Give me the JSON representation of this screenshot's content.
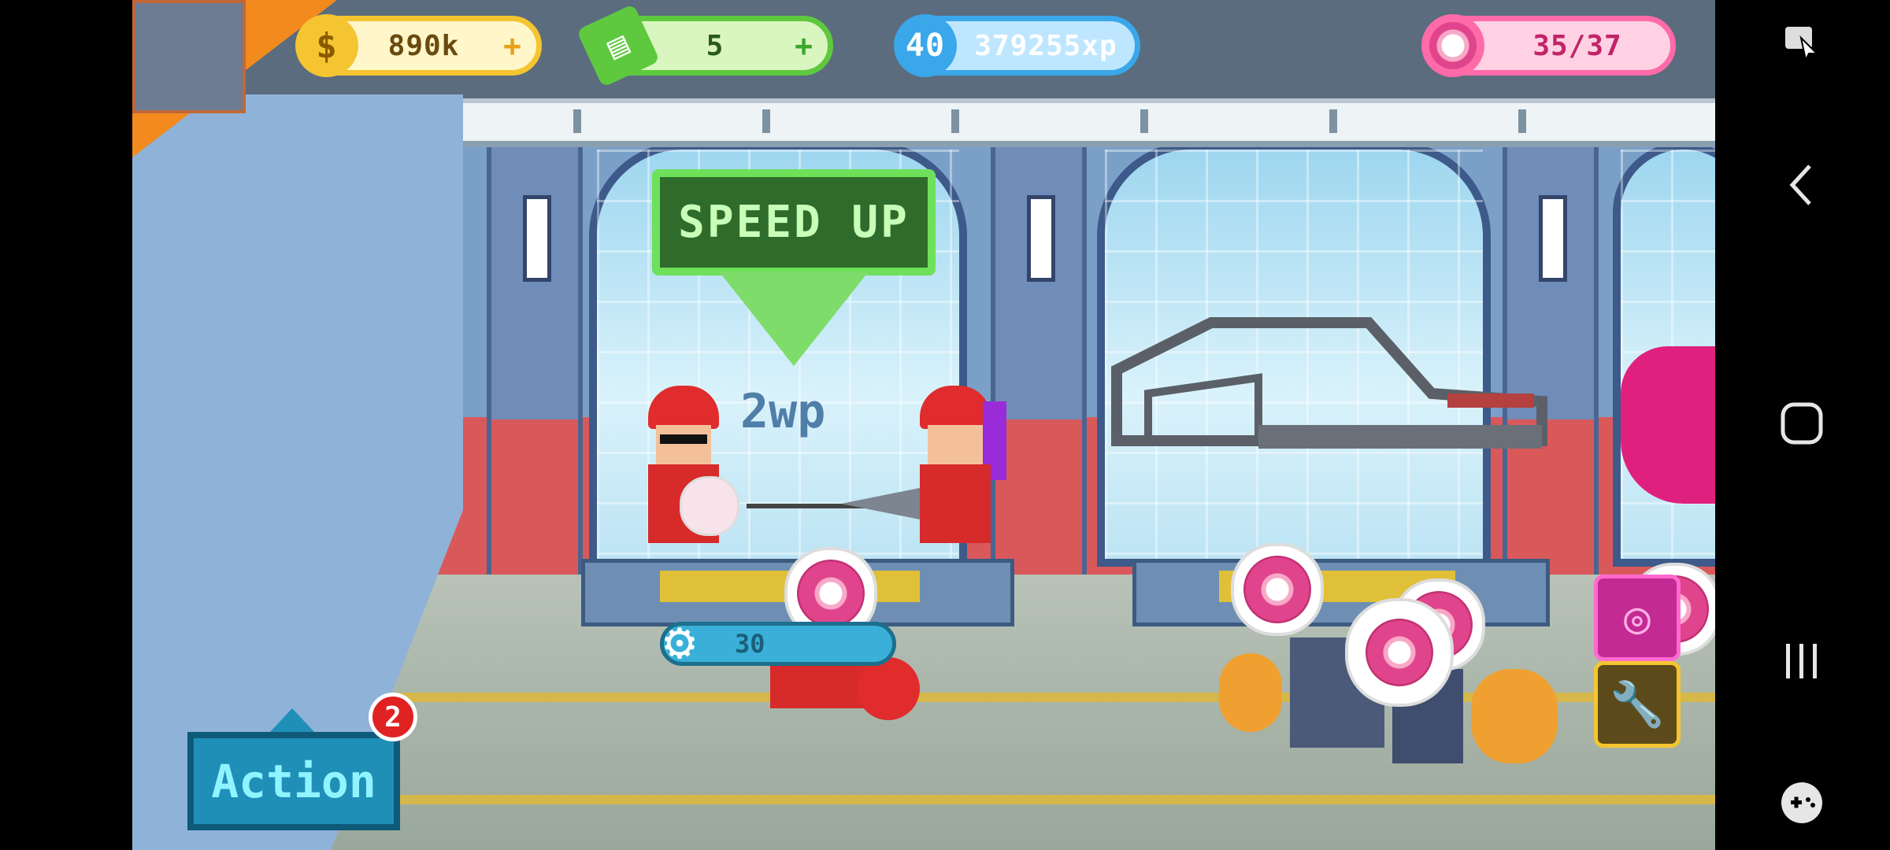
{
  "hud": {
    "coins": "890k",
    "coins_plus": "+",
    "cash": "5",
    "cash_plus": "+",
    "level": "40",
    "xp": "379255xp",
    "donuts": "35/37"
  },
  "speech": {
    "speed_up": "SPEED UP",
    "wp": "2wp"
  },
  "station": {
    "progress_text": "30"
  },
  "action": {
    "label": "Action",
    "badge_count": "2"
  },
  "colors": {
    "coin": "#f4c531",
    "cash": "#5ec93e",
    "xp": "#3aa7ea",
    "donut": "#ff6aa8",
    "action": "#1f8fb8"
  },
  "icons": {
    "nav": [
      "pointer-icon",
      "back-icon",
      "home-icon",
      "recents-icon",
      "gamepad-icon"
    ]
  }
}
